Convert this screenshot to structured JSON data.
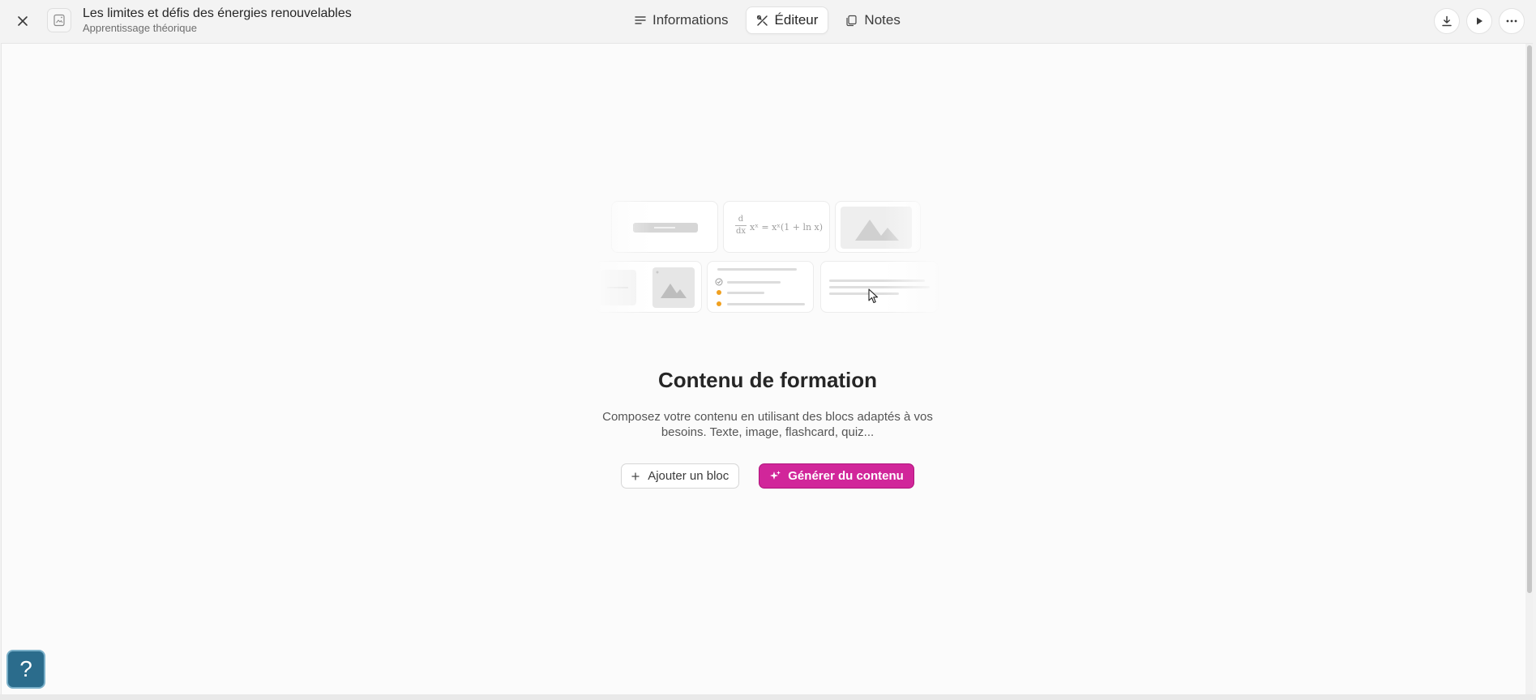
{
  "header": {
    "title": "Les limites et défis des énergies renouvelables",
    "subtitle": "Apprentissage théorique",
    "tabs": [
      {
        "label": "Informations",
        "icon": "lines-icon",
        "active": false
      },
      {
        "label": "Éditeur",
        "icon": "tools-icon",
        "active": true
      },
      {
        "label": "Notes",
        "icon": "pages-icon",
        "active": false
      }
    ],
    "actions": [
      "download-icon",
      "play-icon",
      "more-icon"
    ]
  },
  "illustration": {
    "formula_d": "d",
    "formula_dx": "dx",
    "formula_rhs": "xˣ = xˣ(1 + ln x)"
  },
  "main": {
    "heading": "Contenu de formation",
    "description_line1": "Composez votre contenu en utilisant des blocs adaptés à vos",
    "description_line2": "besoins. Texte, image, flashcard, quiz...",
    "add_block_label": "Ajouter un bloc",
    "generate_label": "Générer du contenu"
  },
  "help": {
    "label": "?"
  },
  "colors": {
    "accent": "#d1269a",
    "help": "#2b6c8c",
    "quiz_check": "#f0a020"
  }
}
